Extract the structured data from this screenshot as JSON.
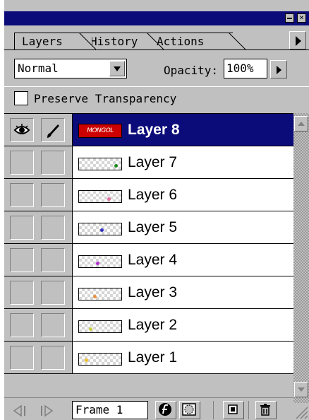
{
  "window": {
    "minimize_label": "",
    "close_label": "×"
  },
  "tabs": [
    {
      "label": "Layers",
      "active": true
    },
    {
      "label": "History",
      "active": false
    },
    {
      "label": "Actions",
      "active": false
    }
  ],
  "blend": {
    "mode": "Normal",
    "opacity_label": "Opacity:",
    "opacity_value": "100%"
  },
  "preserve": {
    "label": "Preserve Transparency",
    "checked": false
  },
  "layers": [
    {
      "name": "Layer 8",
      "selected": true,
      "visible": true,
      "thumb_text": "MONGOL",
      "thumb_color": "#cc0000"
    },
    {
      "name": "Layer 7",
      "selected": false,
      "dot_color": "#1f8a1f"
    },
    {
      "name": "Layer 6",
      "selected": false,
      "dot_color": "#e070a0"
    },
    {
      "name": "Layer 5",
      "selected": false,
      "dot_color": "#3030c0"
    },
    {
      "name": "Layer 4",
      "selected": false,
      "dot_color": "#b030d0"
    },
    {
      "name": "Layer 3",
      "selected": false,
      "dot_color": "#e89040"
    },
    {
      "name": "Layer 2",
      "selected": false,
      "dot_color": "#c8d040"
    },
    {
      "name": "Layer 1",
      "selected": false,
      "dot_color": "#f0c030"
    }
  ],
  "bottom": {
    "frame_label": "Frame 1"
  },
  "colors": {
    "title_bar": "#0b0b7a",
    "selection": "#0b0b7a",
    "panel": "#c0c0c0"
  }
}
